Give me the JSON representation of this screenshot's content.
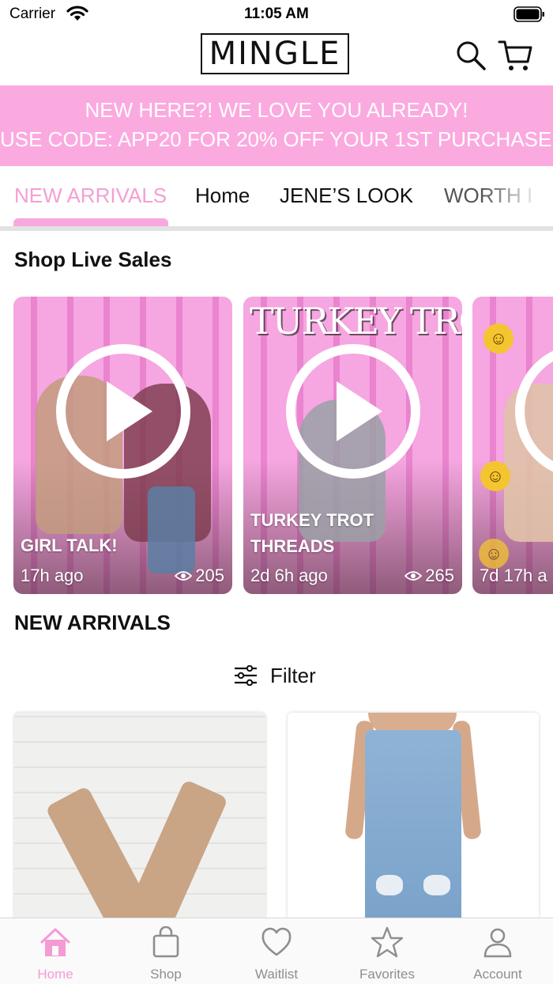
{
  "status_bar": {
    "carrier": "Carrier",
    "time": "11:05 AM"
  },
  "header": {
    "logo": "MINGLE"
  },
  "promo": {
    "line1": "NEW HERE?! WE LOVE YOU ALREADY!",
    "line2": "USE CODE: APP20 FOR 20% OFF YOUR 1ST PURCHASE!"
  },
  "category_tabs": [
    {
      "label": "NEW ARRIVALS",
      "active": true
    },
    {
      "label": "Home",
      "active": false
    },
    {
      "label": "JENE’S LOOK",
      "active": false
    },
    {
      "label": "WORTH I",
      "active": false
    }
  ],
  "live_sales": {
    "title": "Shop Live Sales",
    "cards": [
      {
        "title_line1": "GIRL TALK!",
        "title_line2": "",
        "time_ago": "17h ago",
        "views": "205",
        "overlay_text": ""
      },
      {
        "title_line1": "TURKEY TROT",
        "title_line2": "THREADS",
        "time_ago": "2d 6h ago",
        "views": "265",
        "overlay_text": "TURKEY TROT"
      },
      {
        "title_line1": "",
        "title_line2": "",
        "time_ago": "7d 17h a",
        "views": "",
        "overlay_text": ""
      }
    ]
  },
  "new_arrivals": {
    "title": "NEW ARRIVALS",
    "filter_label": "Filter"
  },
  "tab_bar": [
    {
      "label": "Home",
      "icon": "home-icon",
      "active": true
    },
    {
      "label": "Shop",
      "icon": "bag-icon",
      "active": false
    },
    {
      "label": "Waitlist",
      "icon": "heart-icon",
      "active": false
    },
    {
      "label": "Favorites",
      "icon": "star-icon",
      "active": false
    },
    {
      "label": "Account",
      "icon": "person-icon",
      "active": false
    }
  ],
  "colors": {
    "brand_pink": "#fbaae0",
    "active_pink": "#f59bd4",
    "live_bg_pink": "#f28ed6"
  }
}
